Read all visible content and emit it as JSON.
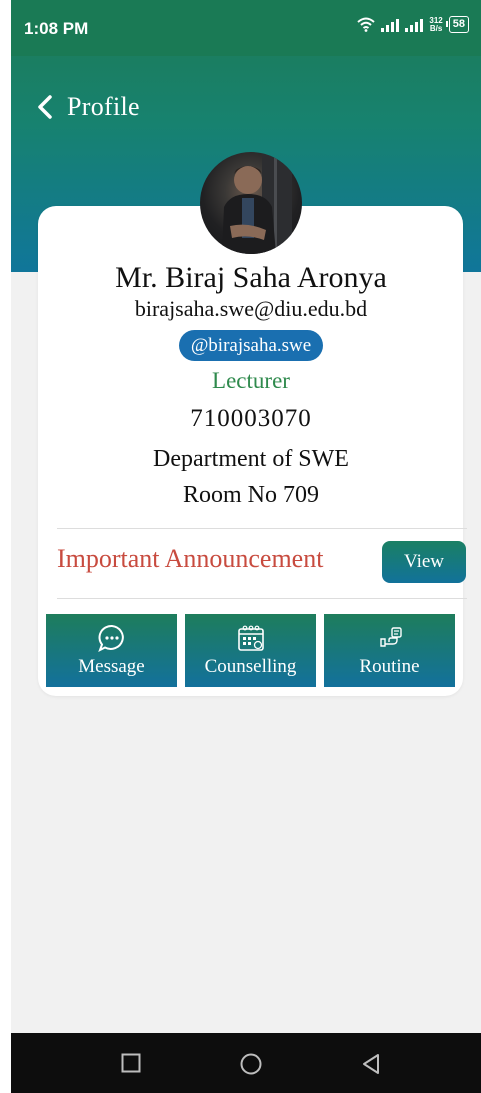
{
  "status_bar": {
    "time": "1:08 PM",
    "speed_top": "312",
    "speed_bottom": "B/s",
    "battery": "58"
  },
  "header": {
    "title": "Profile"
  },
  "profile": {
    "name": "Mr. Biraj Saha Aronya",
    "email": "birajsaha.swe@diu.edu.bd",
    "handle": "@birajsaha.swe",
    "designation": "Lecturer",
    "employee_id": "710003070",
    "department": "Department of SWE",
    "room": "Room No 709"
  },
  "announcement": {
    "label": "Important Announcement",
    "button_label": "View"
  },
  "actions": [
    {
      "label": "Message",
      "icon": "chat-bubble-icon"
    },
    {
      "label": "Counselling",
      "icon": "calendar-icon"
    },
    {
      "label": "Routine",
      "icon": "routine-icon"
    }
  ],
  "nav": {
    "icons": [
      "recent-apps-icon",
      "home-icon",
      "back-nav-icon"
    ]
  },
  "colors": {
    "header_green": "#1e7a55",
    "header_blue": "#10769a",
    "handle_blue": "#1a6fb0",
    "designation_green": "#2f8a4d",
    "announcement_red": "#c84b3f"
  }
}
